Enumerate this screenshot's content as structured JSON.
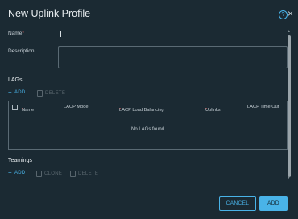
{
  "dialog": {
    "title": "New Uplink Profile",
    "help_icon_glyph": "?",
    "close_icon_glyph": "×"
  },
  "form": {
    "name_label": "Name",
    "required_mark": "*",
    "name_value": "",
    "description_label": "Description",
    "description_value": ""
  },
  "lags": {
    "section_title": "LAGs",
    "add_label": "ADD",
    "delete_label": "DELETE",
    "columns": {
      "name": "Name",
      "mode": "LACP Mode",
      "balancing": "LACP Load Balancing",
      "uplinks": "Uplinks",
      "timeout": "LACP Time Out"
    },
    "empty_text": "No LAGs found"
  },
  "teamings": {
    "section_title": "Teamings",
    "add_label": "ADD",
    "clone_label": "CLONE",
    "delete_label": "DELETE"
  },
  "footer": {
    "cancel_label": "CANCEL",
    "add_label": "ADD"
  },
  "colors": {
    "accent": "#49b3e8",
    "background": "#1b2a33",
    "required": "#e46a6a"
  }
}
